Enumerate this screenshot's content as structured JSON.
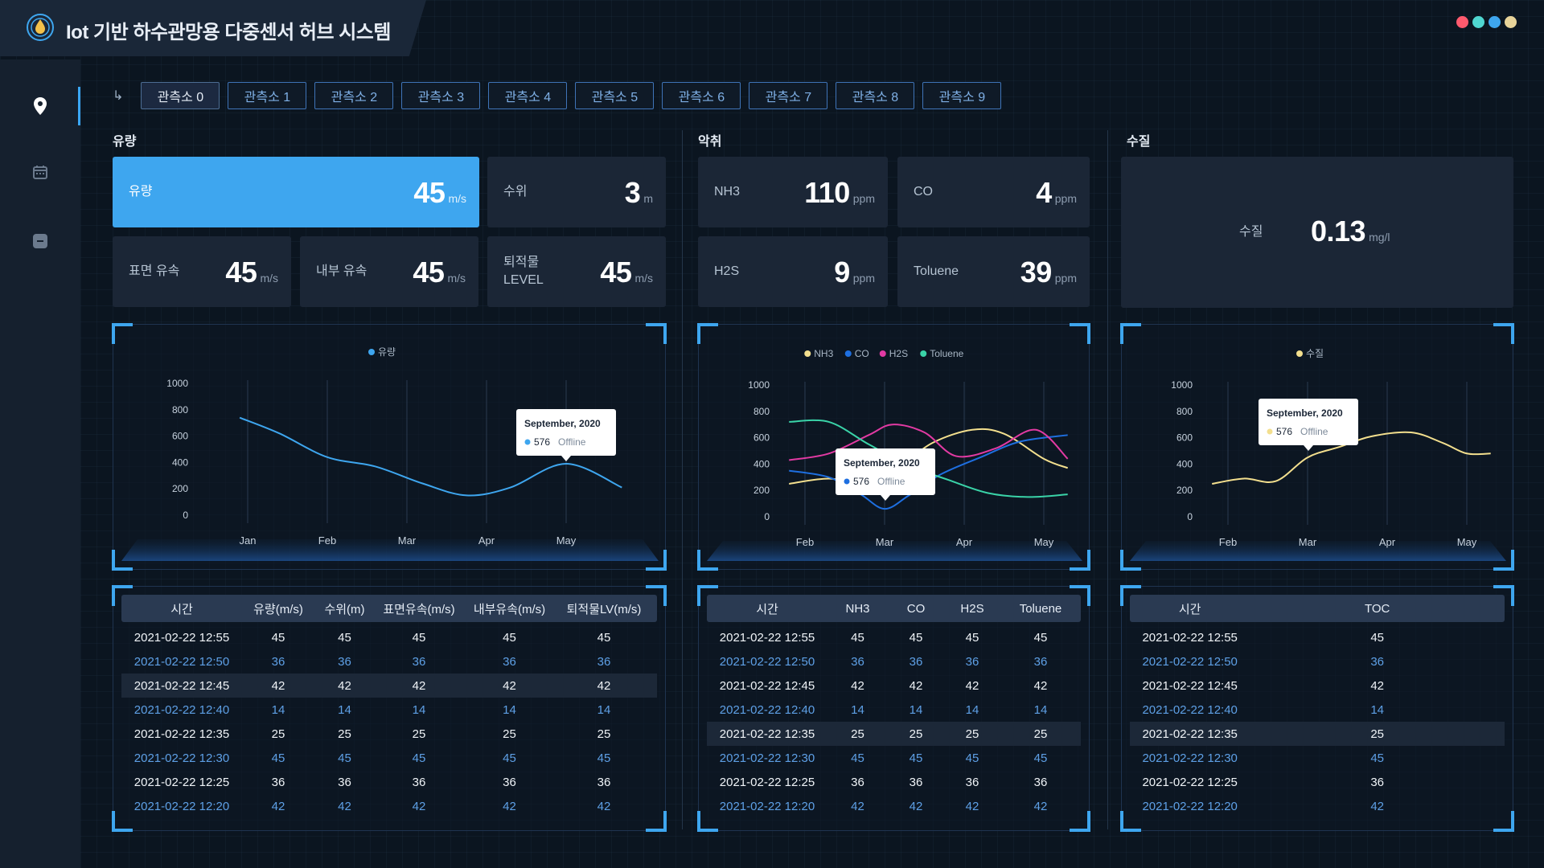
{
  "app": {
    "title": "Iot 기반 하수관망용 다중센서 허브 시스템",
    "window_dots": [
      "#ff5a6e",
      "#4fd6d0",
      "#3ea6ef",
      "#e8d49a"
    ]
  },
  "sidebar": {
    "items": [
      {
        "name": "location-icon",
        "active": true
      },
      {
        "name": "calendar-icon",
        "active": false
      },
      {
        "name": "chat-icon",
        "active": false
      }
    ]
  },
  "tabs": {
    "arrow": "↳",
    "items": [
      "관측소 0",
      "관측소 1",
      "관측소 2",
      "관측소 3",
      "관측소 4",
      "관측소 5",
      "관측소 6",
      "관측소 7",
      "관측소 8",
      "관측소 9"
    ],
    "active_index": 0
  },
  "sections": {
    "flow": {
      "title": "유량",
      "cards": [
        {
          "label": "유량",
          "value": "45",
          "unit": "m/s"
        },
        {
          "label": "수위",
          "value": "3",
          "unit": "m"
        },
        {
          "label": "표면 유속",
          "value": "45",
          "unit": "m/s"
        },
        {
          "label": "내부 유속",
          "value": "45",
          "unit": "m/s"
        },
        {
          "label": "퇴적물 LEVEL",
          "value": "45",
          "unit": "m/s"
        }
      ]
    },
    "odor": {
      "title": "악취",
      "cards": [
        {
          "label": "NH3",
          "value": "110",
          "unit": "ppm"
        },
        {
          "label": "CO",
          "value": "4",
          "unit": "ppm"
        },
        {
          "label": "H2S",
          "value": "9",
          "unit": "ppm"
        },
        {
          "label": "Toluene",
          "value": "39",
          "unit": "ppm"
        }
      ]
    },
    "water": {
      "title": "수질",
      "cards": [
        {
          "label": "수질",
          "value": "0.13",
          "unit": "mg/l"
        }
      ]
    }
  },
  "tooltip": {
    "title": "September, 2020",
    "value": "576",
    "status": "Offline"
  },
  "chart_data": [
    {
      "type": "line",
      "x": [
        "Jan",
        "Feb",
        "Mar",
        "Apr",
        "May"
      ],
      "ylim": [
        0,
        1000
      ],
      "yticks": [
        0,
        200,
        400,
        600,
        800,
        1000
      ],
      "legend_position": "top-center",
      "series": [
        {
          "name": "유량",
          "color": "#3ea6ef",
          "points": [
            [
              -0.1,
              740
            ],
            [
              0.4,
              620
            ],
            [
              1.0,
              440
            ],
            [
              1.6,
              370
            ],
            [
              2.2,
              240
            ],
            [
              2.75,
              150
            ],
            [
              3.3,
              210
            ],
            [
              4.0,
              390
            ],
            [
              4.7,
              210
            ]
          ]
        }
      ]
    },
    {
      "type": "line",
      "x": [
        "Feb",
        "Mar",
        "Apr",
        "May"
      ],
      "ylim": [
        0,
        1000
      ],
      "yticks": [
        0,
        200,
        400,
        600,
        800,
        1000
      ],
      "legend_position": "top-center",
      "series": [
        {
          "name": "NH3",
          "color": "#f3df8e",
          "points": [
            [
              -0.2,
              250
            ],
            [
              0.3,
              290
            ],
            [
              0.8,
              250
            ],
            [
              1.2,
              380
            ],
            [
              1.6,
              560
            ],
            [
              2.1,
              660
            ],
            [
              2.5,
              630
            ],
            [
              3.0,
              440
            ],
            [
              3.3,
              370
            ]
          ]
        },
        {
          "name": "CO",
          "color": "#1e6fe0",
          "points": [
            [
              -0.2,
              350
            ],
            [
              0.3,
              300
            ],
            [
              0.7,
              170
            ],
            [
              1.0,
              60
            ],
            [
              1.3,
              160
            ],
            [
              1.7,
              320
            ],
            [
              2.2,
              450
            ],
            [
              2.7,
              570
            ],
            [
              3.3,
              620
            ]
          ]
        },
        {
          "name": "H2S",
          "color": "#e23aa3",
          "points": [
            [
              -0.2,
              430
            ],
            [
              0.3,
              480
            ],
            [
              0.8,
              620
            ],
            [
              1.1,
              700
            ],
            [
              1.5,
              640
            ],
            [
              1.9,
              460
            ],
            [
              2.4,
              520
            ],
            [
              2.9,
              660
            ],
            [
              3.3,
              440
            ]
          ]
        },
        {
          "name": "Toluene",
          "color": "#3ad3a8",
          "points": [
            [
              -0.2,
              720
            ],
            [
              0.3,
              720
            ],
            [
              0.8,
              550
            ],
            [
              1.3,
              390
            ],
            [
              1.8,
              280
            ],
            [
              2.3,
              180
            ],
            [
              2.8,
              150
            ],
            [
              3.3,
              170
            ]
          ]
        }
      ]
    },
    {
      "type": "line",
      "x": [
        "Feb",
        "Mar",
        "Apr",
        "May"
      ],
      "ylim": [
        0,
        1000
      ],
      "yticks": [
        0,
        200,
        400,
        600,
        800,
        1000
      ],
      "legend_position": "top-center",
      "series": [
        {
          "name": "수질",
          "color": "#f3df8e",
          "points": [
            [
              -0.2,
              250
            ],
            [
              0.2,
              290
            ],
            [
              0.6,
              270
            ],
            [
              1.0,
              450
            ],
            [
              1.4,
              530
            ],
            [
              1.8,
              610
            ],
            [
              2.3,
              640
            ],
            [
              2.7,
              560
            ],
            [
              3.0,
              480
            ],
            [
              3.3,
              480
            ]
          ]
        }
      ]
    }
  ],
  "tables": {
    "flow": {
      "headers": [
        "시간",
        "유량(m/s)",
        "수위(m)",
        "표면유속(m/s)",
        "내부유속(m/s)",
        "퇴적물LV(m/s)"
      ],
      "rows": [
        [
          "2021-02-22 12:55",
          "45",
          "45",
          "45",
          "45",
          "45"
        ],
        [
          "2021-02-22 12:50",
          "36",
          "36",
          "36",
          "36",
          "36"
        ],
        [
          "2021-02-22 12:45",
          "42",
          "42",
          "42",
          "42",
          "42"
        ],
        [
          "2021-02-22 12:40",
          "14",
          "14",
          "14",
          "14",
          "14"
        ],
        [
          "2021-02-22 12:35",
          "25",
          "25",
          "25",
          "25",
          "25"
        ],
        [
          "2021-02-22 12:30",
          "45",
          "45",
          "45",
          "45",
          "45"
        ],
        [
          "2021-02-22 12:25",
          "36",
          "36",
          "36",
          "36",
          "36"
        ],
        [
          "2021-02-22 12:20",
          "42",
          "42",
          "42",
          "42",
          "42"
        ]
      ],
      "highlight_row": 2
    },
    "odor": {
      "headers": [
        "시간",
        "NH3",
        "CO",
        "H2S",
        "Toluene"
      ],
      "rows": [
        [
          "2021-02-22 12:55",
          "45",
          "45",
          "45",
          "45"
        ],
        [
          "2021-02-22 12:50",
          "36",
          "36",
          "36",
          "36"
        ],
        [
          "2021-02-22 12:45",
          "42",
          "42",
          "42",
          "42"
        ],
        [
          "2021-02-22 12:40",
          "14",
          "14",
          "14",
          "14"
        ],
        [
          "2021-02-22 12:35",
          "25",
          "25",
          "25",
          "25"
        ],
        [
          "2021-02-22 12:30",
          "45",
          "45",
          "45",
          "45"
        ],
        [
          "2021-02-22 12:25",
          "36",
          "36",
          "36",
          "36"
        ],
        [
          "2021-02-22 12:20",
          "42",
          "42",
          "42",
          "42"
        ]
      ],
      "highlight_row": 4
    },
    "water": {
      "headers": [
        "시간",
        "TOC"
      ],
      "rows": [
        [
          "2021-02-22 12:55",
          "45"
        ],
        [
          "2021-02-22 12:50",
          "36"
        ],
        [
          "2021-02-22 12:45",
          "42"
        ],
        [
          "2021-02-22 12:40",
          "14"
        ],
        [
          "2021-02-22 12:35",
          "25"
        ],
        [
          "2021-02-22 12:30",
          "45"
        ],
        [
          "2021-02-22 12:25",
          "36"
        ],
        [
          "2021-02-22 12:20",
          "42"
        ]
      ],
      "highlight_row": 4
    }
  }
}
